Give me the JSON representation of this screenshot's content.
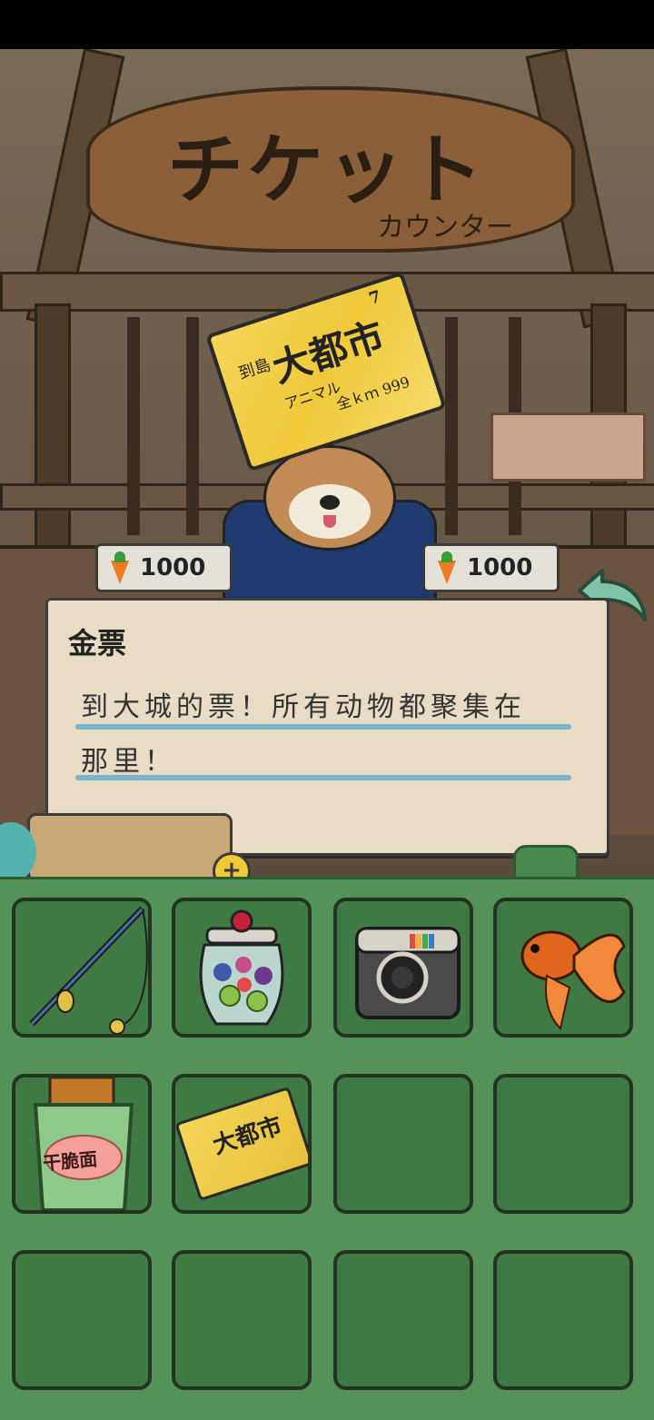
{
  "sign": {
    "title": "チケット",
    "subtitle": "カウンター"
  },
  "ticket": {
    "line1": "到島",
    "line2": "大都市",
    "line3": "アニマル",
    "line4": "全ｋｍ 999",
    "corner": "7"
  },
  "counter": {
    "price_left": "1000",
    "price_right": "1000"
  },
  "dialog": {
    "title": "金票",
    "line1": "到大城的票！所有动物都聚集在",
    "line2": "那里！"
  },
  "inventory": {
    "slots": [
      {
        "item": "fishing-rod"
      },
      {
        "item": "fruit-jar"
      },
      {
        "item": "instant-camera"
      },
      {
        "item": "goldfish"
      },
      {
        "item": "crispy-noodles",
        "label": "干脆面"
      },
      {
        "item": "gold-ticket",
        "label": "大都市"
      },
      {
        "item": ""
      },
      {
        "item": ""
      },
      {
        "item": ""
      },
      {
        "item": ""
      },
      {
        "item": ""
      },
      {
        "item": ""
      }
    ]
  },
  "colors": {
    "inventory_bg": "#549259",
    "slot_bg": "#3f7a44",
    "dialog_bg": "#e8ddc4",
    "rule": "#7eb0cf",
    "ticket_gold": "#f0c93a",
    "back_arrow": "#7fc4a7"
  }
}
